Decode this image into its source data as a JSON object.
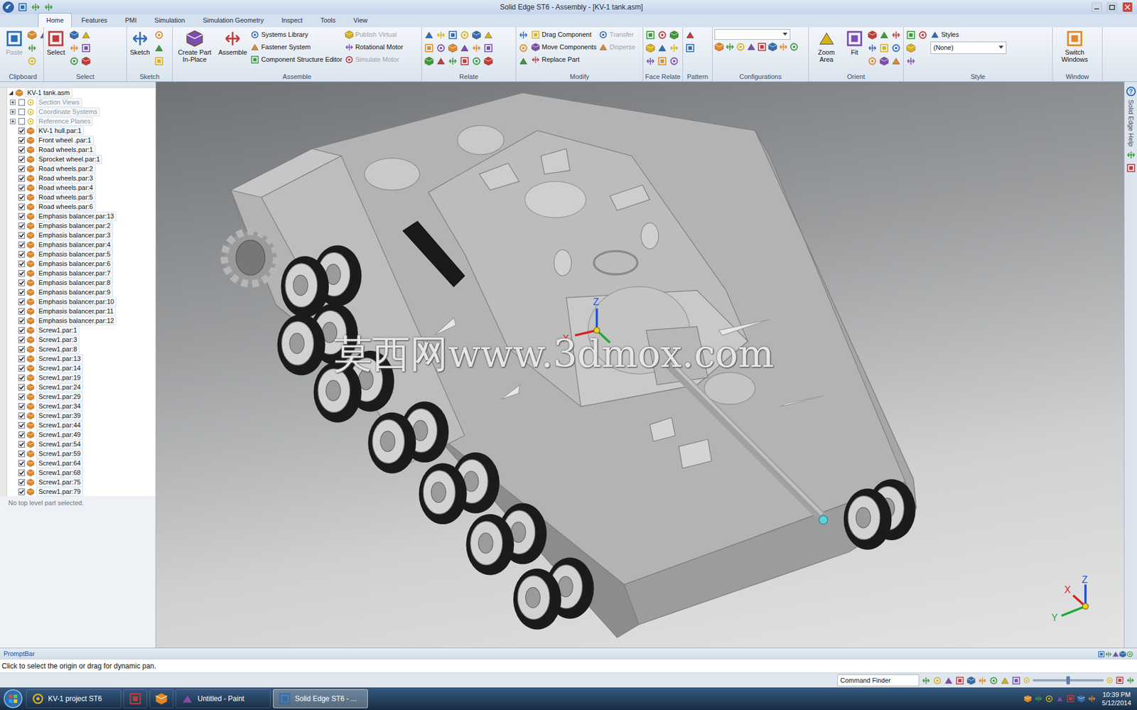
{
  "window": {
    "title": "Solid Edge ST6 - Assembly - [KV-1 tank.asm]"
  },
  "ribbon": {
    "tabs": [
      {
        "label": "Home",
        "selected": true
      },
      {
        "label": "Features",
        "selected": false
      },
      {
        "label": "PMI",
        "selected": false
      },
      {
        "label": "Simulation",
        "selected": false
      },
      {
        "label": "Simulation Geometry",
        "selected": false
      },
      {
        "label": "Inspect",
        "selected": false
      },
      {
        "label": "Tools",
        "selected": false
      },
      {
        "label": "View",
        "selected": false
      }
    ],
    "groups": [
      {
        "label": "Clipboard",
        "buttons": [
          {
            "label": "Paste",
            "kind": "large",
            "disabled": true
          }
        ]
      },
      {
        "label": "Select",
        "buttons": [
          {
            "label": "Select",
            "kind": "large",
            "disabled": false
          }
        ]
      },
      {
        "label": "Sketch",
        "buttons": [
          {
            "label": "Sketch",
            "kind": "large",
            "disabled": false
          }
        ]
      },
      {
        "label": "Assemble",
        "buttons": [
          {
            "label": "Create Part In-Place",
            "kind": "large",
            "disabled": false
          },
          {
            "label": "Assemble",
            "kind": "large",
            "disabled": false
          },
          {
            "label": "Systems Library",
            "kind": "small",
            "disabled": false
          },
          {
            "label": "Fastener System",
            "kind": "small",
            "disabled": false
          },
          {
            "label": "Component Structure Editor",
            "kind": "small",
            "disabled": false
          },
          {
            "label": "Publish Virtual",
            "kind": "small",
            "disabled": true
          },
          {
            "label": "Rotational Motor",
            "kind": "small",
            "disabled": false
          },
          {
            "label": "Simulate Motor",
            "kind": "small",
            "disabled": true
          }
        ]
      },
      {
        "label": "Relate",
        "buttons": []
      },
      {
        "label": "Modify",
        "buttons": [
          {
            "label": "Drag Component",
            "kind": "small",
            "disabled": false
          },
          {
            "label": "Move Components",
            "kind": "small",
            "disabled": false
          },
          {
            "label": "Replace Part",
            "kind": "small",
            "disabled": false
          },
          {
            "label": "Transfer",
            "kind": "small",
            "disabled": true
          },
          {
            "label": "Disperse",
            "kind": "small",
            "disabled": true
          }
        ]
      },
      {
        "label": "Face Relate",
        "buttons": []
      },
      {
        "label": "Pattern",
        "buttons": []
      },
      {
        "label": "Configurations",
        "buttons": [],
        "field": ""
      },
      {
        "label": "Orient",
        "buttons": [
          {
            "label": "Zoom Area",
            "kind": "large",
            "disabled": false
          },
          {
            "label": "Fit",
            "kind": "large",
            "disabled": false
          }
        ]
      },
      {
        "label": "Style",
        "buttons": [
          {
            "label": "Styles",
            "kind": "small",
            "disabled": false
          }
        ],
        "field": "(None)"
      },
      {
        "label": "Window",
        "buttons": [
          {
            "label": "Switch Windows",
            "kind": "large",
            "disabled": false
          }
        ]
      }
    ]
  },
  "tree": {
    "root": {
      "label": "KV-1 tank.asm",
      "expanded": true
    },
    "folders": [
      {
        "label": "Section Views",
        "expanded": false,
        "checked": false
      },
      {
        "label": "Coordinate Systems",
        "expanded": false,
        "checked": false
      },
      {
        "label": "Reference Planes",
        "expanded": false,
        "checked": false
      }
    ],
    "parts": [
      {
        "label": "KV-1 hull.par:1",
        "checked": true
      },
      {
        "label": "Front wheel .par:1",
        "checked": true
      },
      {
        "label": "Road wheels.par:1",
        "checked": true
      },
      {
        "label": "Sprocket wheel.par:1",
        "checked": true
      },
      {
        "label": "Road wheels.par:2",
        "checked": true
      },
      {
        "label": "Road wheels.par:3",
        "checked": true
      },
      {
        "label": "Road wheels.par:4",
        "checked": true
      },
      {
        "label": "Road wheels.par:5",
        "checked": true
      },
      {
        "label": "Road wheels.par:6",
        "checked": true
      },
      {
        "label": "Emphasis balancer.par:13",
        "checked": true
      },
      {
        "label": "Emphasis balancer.par:2",
        "checked": true
      },
      {
        "label": "Emphasis balancer.par:3",
        "checked": true
      },
      {
        "label": "Emphasis balancer.par:4",
        "checked": true
      },
      {
        "label": "Emphasis balancer.par:5",
        "checked": true
      },
      {
        "label": "Emphasis balancer.par:6",
        "checked": true
      },
      {
        "label": "Emphasis balancer.par:7",
        "checked": true
      },
      {
        "label": "Emphasis balancer.par:8",
        "checked": true
      },
      {
        "label": "Emphasis balancer.par:9",
        "checked": true
      },
      {
        "label": "Emphasis balancer.par:10",
        "checked": true
      },
      {
        "label": "Emphasis balancer.par:11",
        "checked": true
      },
      {
        "label": "Emphasis balancer.par:12",
        "checked": true
      },
      {
        "label": "Screw1.par:1",
        "checked": true
      },
      {
        "label": "Screw1.par:3",
        "checked": true
      },
      {
        "label": "Screw1.par:8",
        "checked": true
      },
      {
        "label": "Screw1.par:13",
        "checked": true
      },
      {
        "label": "Screw1.par:14",
        "checked": true
      },
      {
        "label": "Screw1.par:19",
        "checked": true
      },
      {
        "label": "Screw1.par:24",
        "checked": true
      },
      {
        "label": "Screw1.par:29",
        "checked": true
      },
      {
        "label": "Screw1.par:34",
        "checked": true
      },
      {
        "label": "Screw1.par:39",
        "checked": true
      },
      {
        "label": "Screw1.par:44",
        "checked": true
      },
      {
        "label": "Screw1.par:49",
        "checked": true
      },
      {
        "label": "Screw1.par:54",
        "checked": true
      },
      {
        "label": "Screw1.par:59",
        "checked": true
      },
      {
        "label": "Screw1.par:64",
        "checked": true
      },
      {
        "label": "Screw1.par:68",
        "checked": true
      },
      {
        "label": "Screw1.par:75",
        "checked": true
      },
      {
        "label": "Screw1.par:79",
        "checked": true
      }
    ],
    "status": "No top level part selected."
  },
  "viewport": {
    "watermark": "莫西网www.3dmox.com",
    "model_triad": [
      "Z",
      "X"
    ],
    "view_triad": [
      "Z",
      "X",
      "Y"
    ]
  },
  "help_strip": {
    "icon": "?",
    "label": "Solid Edge Help"
  },
  "prompt": {
    "title": "PromptBar",
    "text": "Click to select the origin or drag for dynamic pan."
  },
  "status_bar": {
    "command_finder": "Command Finder",
    "zoom_level": 0.5
  },
  "taskbar": {
    "items": [
      {
        "kind": "folder",
        "label": "KV-1 project ST6",
        "selected": false
      },
      {
        "kind": "chrome",
        "selected": false
      },
      {
        "kind": "firefox",
        "selected": false
      },
      {
        "kind": "paint",
        "label": "Untitled - Paint",
        "selected": false
      },
      {
        "kind": "solidedge",
        "label": "Solid Edge ST6 - ...",
        "selected": true
      }
    ],
    "time": "10:39 PM",
    "date": "5/12/2014"
  }
}
